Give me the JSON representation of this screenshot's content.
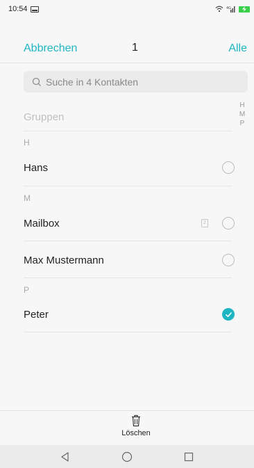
{
  "status_bar": {
    "time": "10:54"
  },
  "top_bar": {
    "cancel_label": "Abbrechen",
    "selected_count": "1",
    "all_label": "Alle"
  },
  "search": {
    "placeholder": "Suche in 4 Kontakten"
  },
  "groups_label": "Gruppen",
  "index_letters": [
    "H",
    "M",
    "P"
  ],
  "sections": [
    {
      "letter": "H",
      "contacts": [
        {
          "name": "Hans",
          "checked": false,
          "sim": false
        }
      ]
    },
    {
      "letter": "M",
      "contacts": [
        {
          "name": "Mailbox",
          "checked": false,
          "sim": true
        },
        {
          "name": "Max Mustermann",
          "checked": false,
          "sim": false
        }
      ]
    },
    {
      "letter": "P",
      "contacts": [
        {
          "name": "Peter",
          "checked": true,
          "sim": false
        }
      ]
    }
  ],
  "bottom_action": {
    "label": "Löschen",
    "icon": "trash-icon"
  },
  "colors": {
    "accent": "#1fb6c4",
    "battery": "#3ad04b"
  }
}
